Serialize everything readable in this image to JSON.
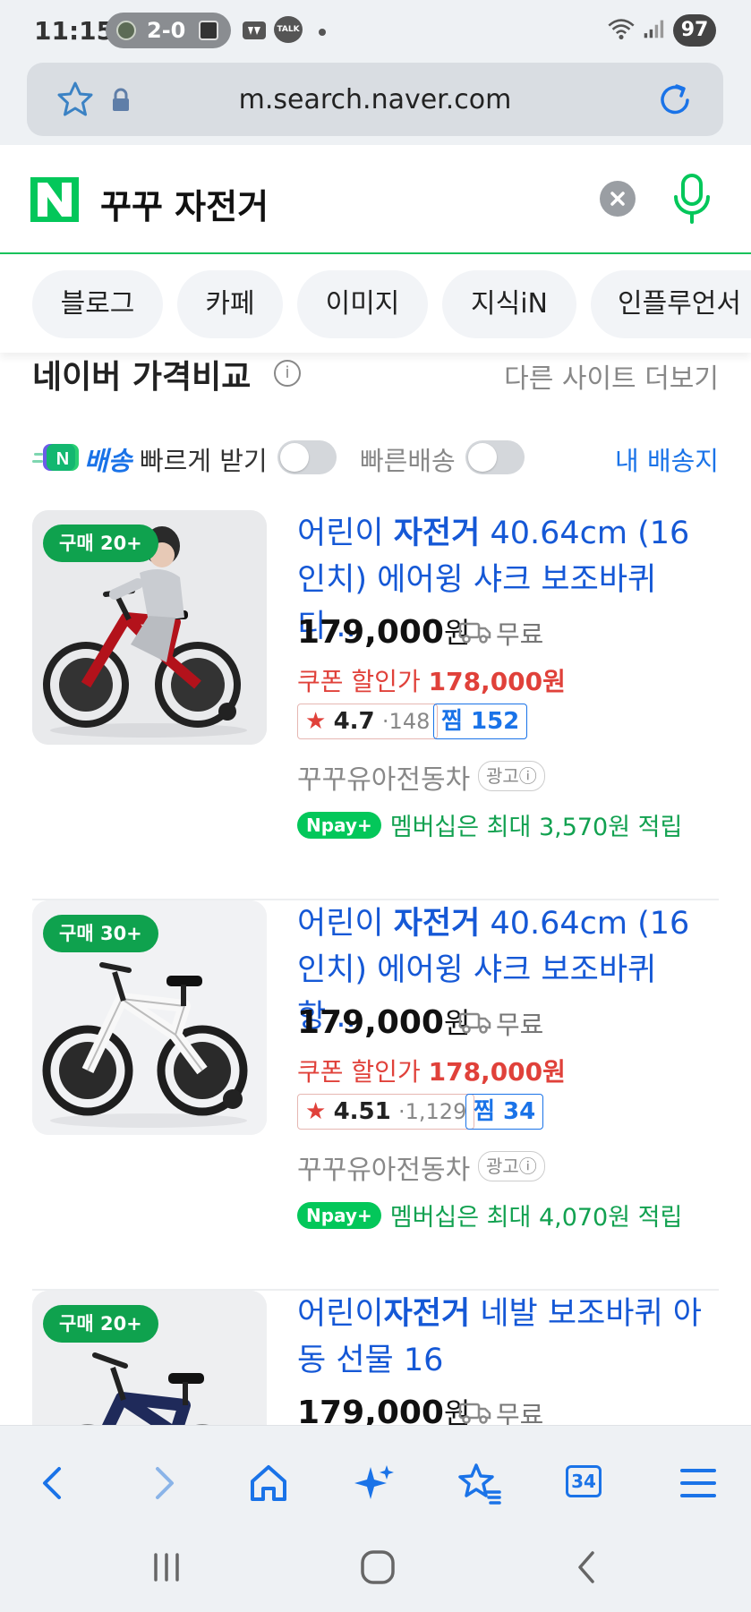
{
  "status": {
    "time": "11:15",
    "score": "2-0",
    "battery": "97",
    "talk": "TALK"
  },
  "browser": {
    "url": "m.search.naver.com"
  },
  "search": {
    "logo": "N",
    "query": "꾸꾸 자전거"
  },
  "tabs": [
    "블로그",
    "카페",
    "이미지",
    "지식iN",
    "인플루언서"
  ],
  "section": {
    "title": "네이버 가격비교",
    "info": "i",
    "more_sites": "다른 사이트 더보기"
  },
  "filters": {
    "badge": "N",
    "delivery_word": "배송",
    "fast_receive": "빠르게 받기",
    "fast_delivery": "빠른배송",
    "my_address": "내 배송지"
  },
  "products": [
    {
      "badge": "구매 20+",
      "title_pre": "어린이 ",
      "title_bold": "자전거",
      "title_post": " 40.64cm (16인치) 에어윙 샤크 보조바퀴 디...",
      "price": "179,000",
      "won": "원",
      "shipping": "무료",
      "coupon_label": "쿠폰 할인가 ",
      "coupon_price": "178,000원",
      "rating": "4.7",
      "reviews": "148",
      "zzim": "찜 152",
      "seller": "꾸꾸유아전동차",
      "ad": "광고ⓘ",
      "npay": "Npay+",
      "npay_text": "멤버십은 최대 3,570원 적립"
    },
    {
      "badge": "구매 30+",
      "title_pre": "어린이 ",
      "title_bold": "자전거",
      "title_post": " 40.64cm (16인치) 에어윙 샤크 보조바퀴 항...",
      "price": "179,000",
      "won": "원",
      "shipping": "무료",
      "coupon_label": "쿠폰 할인가 ",
      "coupon_price": "178,000원",
      "rating": "4.51",
      "reviews": "1,129",
      "zzim": "찜 34",
      "seller": "꾸꾸유아전동차",
      "ad": "광고ⓘ",
      "npay": "Npay+",
      "npay_text": "멤버십은 최대 4,070원 적립"
    },
    {
      "badge": "구매 20+",
      "title_pre": "어린이",
      "title_bold": "자전거",
      "title_post": " 네발 보조바퀴 아동 선물 16",
      "price": "179,000",
      "won": "원",
      "shipping": "무료"
    }
  ],
  "toolbar": {
    "tab_count": "34"
  },
  "colors": {
    "naver_green": "#03c75a",
    "link_blue": "#1558d6",
    "coupon_red": "#e0413a"
  }
}
